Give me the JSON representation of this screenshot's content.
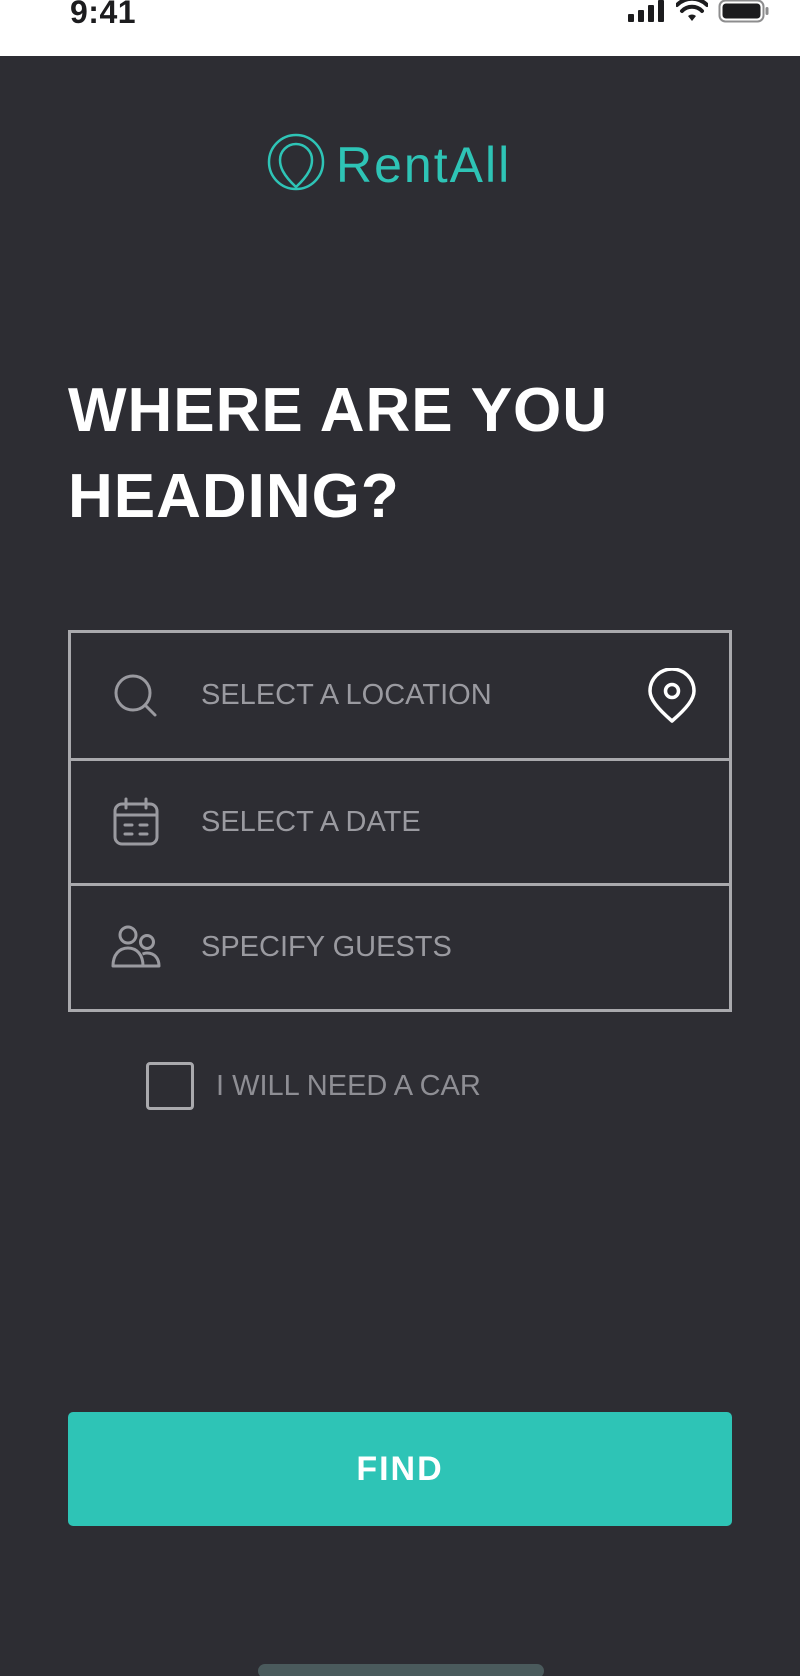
{
  "status_bar": {
    "time": "9:41",
    "icons": [
      "signal-icon",
      "wifi-icon",
      "battery-icon"
    ]
  },
  "brand": {
    "name": "RentAll",
    "accent_color": "#2ec4b6",
    "icon": "logo-pin-icon"
  },
  "heading": "WHERE ARE YOU HEADING?",
  "form": {
    "location": {
      "placeholder": "SELECT A LOCATION",
      "icon": "search-icon",
      "action_icon": "location-pin-icon"
    },
    "date": {
      "placeholder": "SELECT A DATE",
      "icon": "calendar-icon"
    },
    "guests": {
      "placeholder": "SPECIFY GUESTS",
      "icon": "guests-icon"
    }
  },
  "car_option": {
    "label": "I WILL NEED A CAR",
    "checked": false
  },
  "find_button": {
    "label": "FIND"
  },
  "colors": {
    "background": "#2d2d33",
    "border": "#a9a9ad",
    "placeholder": "#9a9aa0",
    "button": "#2ec4b6"
  }
}
